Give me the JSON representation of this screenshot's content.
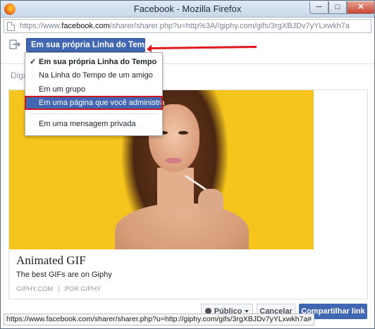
{
  "window": {
    "title": "Facebook - Mozilla Firefox",
    "minimize_label": "─",
    "maximize_label": "□",
    "close_label": "✕"
  },
  "urlbar": {
    "prefix": "https://www.",
    "domain": "facebook.com",
    "rest": "/sharer/sharer.php?u=http%3A//giphy.com/gifs/3rgXBJDv7yYLxwkh7a"
  },
  "share": {
    "target_label": "Em sua própria Linha do Tempo",
    "composer_placeholder": "Diga",
    "menu": [
      {
        "label": "Em sua própria Linha do Tempo",
        "checked": true
      },
      {
        "label": "Na Linha do Tempo de um amigo",
        "checked": false
      },
      {
        "label": "Em um grupo",
        "checked": false
      },
      {
        "label": "Em uma página que você administra",
        "checked": false,
        "highlighted": true
      },
      {
        "label": "Em uma mensagem privada",
        "checked": false
      }
    ]
  },
  "preview": {
    "title": "Animated GIF",
    "description": "The best GIFs are on Giphy",
    "source": "GIPHY.COM",
    "separator": "|",
    "author": "POR GIPHY"
  },
  "footer": {
    "audience_label": "Público",
    "cancel_label": "Cancelar",
    "share_label": "Compartilhar link"
  },
  "status": {
    "url": "https://www.facebook.com/sharer/sharer.php?u=http://giphy.com/gifs/3rgXBJDv7yYLxwkh7a#"
  },
  "colors": {
    "facebook_blue": "#4267b2",
    "highlight_outline": "#d0161d",
    "image_background": "#f5c51d"
  }
}
